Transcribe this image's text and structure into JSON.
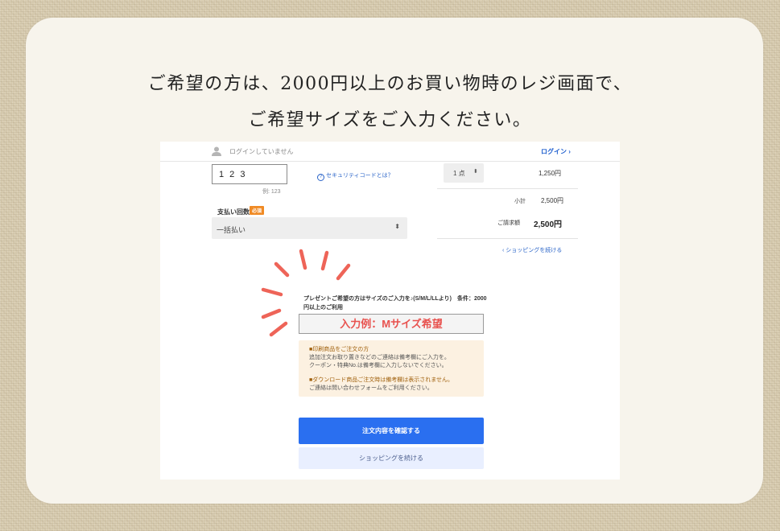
{
  "heading": {
    "line1": "ご希望の方は、2000円以上のお買い物時のレジ画面で、",
    "line2": "ご希望サイズをご入力ください。"
  },
  "header": {
    "login_status": "ログインしていません",
    "login_link": "ログイン ›"
  },
  "payment": {
    "security_code_value": "1 2 3",
    "security_code_hint": "例: 123",
    "security_code_link": "セキュリティコードとは？",
    "installments_label": "支払い回数",
    "required_badge": "必須",
    "installments_value": "一括払い",
    "select_arrow": "⬍"
  },
  "order_summary": {
    "quantity": "1 点",
    "quantity_arrow": "⬍",
    "line_price": "1,250円",
    "subtotal_label": "小計",
    "subtotal_value": "2,500円",
    "total_label": "ご請求額",
    "total_value": "2,500円",
    "continue_link": "‹  ショッピングを続ける"
  },
  "remarks": {
    "present_note": "プレゼントご希望の方はサイズのご入力を♪(S/M/L/LLより)　条件：2000円以上のご利用",
    "example_value": "入力例：Mサイズ希望"
  },
  "notice": {
    "print_heading": "■印刷商品をご注文の方",
    "print_line1": "追加注文お取り置きなどのご連絡は備考欄にご入力を。",
    "print_line2": "クーポン・特典No.は備考欄に入力しないでください。",
    "download_heading": "■ダウンロード商品ご注文時は備考欄は表示されません。",
    "download_line1": "ご連絡は問い合わせフォームをご利用ください。"
  },
  "buttons": {
    "confirm": "注文内容を確認する",
    "continue_shopping": "ショッピングを続ける"
  },
  "colors": {
    "accent_blue": "#2a6ff0",
    "highlight_red": "#e8524f",
    "burst_coral": "#ee6458",
    "required_orange": "#f08a24"
  },
  "icons": {
    "user": "user-icon",
    "security_help": "question-circle-icon",
    "burst": "emphasis-burst-icon"
  }
}
